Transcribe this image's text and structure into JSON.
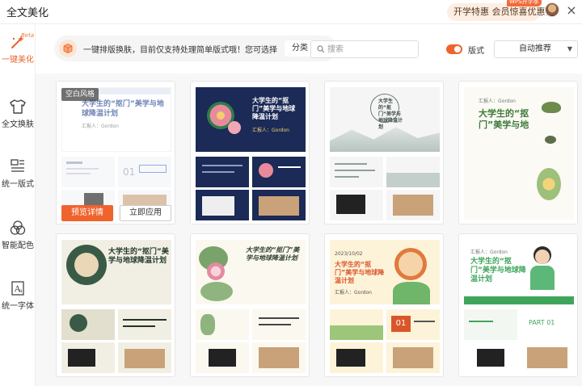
{
  "window": {
    "title": "全文美化",
    "promo_text": "开学特惠 会员惊喜优惠价",
    "promo_badge": "WPS开学季",
    "close_symbol": "×"
  },
  "sidebar": {
    "items": [
      {
        "label": "一键美化",
        "icon": "magic-wand-icon",
        "badge": "Beta",
        "active": true
      },
      {
        "label": "全文换肤",
        "icon": "tshirt-icon"
      },
      {
        "label": "统一版式",
        "icon": "layout-icon"
      },
      {
        "label": "智能配色",
        "icon": "color-circles-icon"
      },
      {
        "label": "统一字体",
        "icon": "font-icon"
      }
    ]
  },
  "toolbar": {
    "notice": "一键排版换肤，目前仅支持处理简单版式哦！您可选择",
    "classify_label": "分类",
    "search_placeholder": "搜索",
    "layout_toggle_label": "版式",
    "layout_toggle_on": true,
    "sort_value": "自动推荐"
  },
  "templates": [
    {
      "title": "大学生的“抠门”美学与地球降温计划",
      "presenter": "汇报人：Gordon",
      "style_tag": "空白风格",
      "preview_label": "预览详情",
      "apply_label": "立即应用",
      "hovered": true
    },
    {
      "title": "大学生的“抠门”美学与地球降温计划",
      "presenter": "汇报人：Gordon"
    },
    {
      "title": "大学生的“抠门”美学与地球降温计划",
      "presenter": ""
    },
    {
      "title": "大学生的“抠门”美学与地",
      "presenter": "汇报人：Gordon"
    },
    {
      "title": "大学生的“抠门”美学与地球降温计划",
      "presenter": ""
    },
    {
      "title": "大学生的“抠门”美学与地球降温计划",
      "presenter": ""
    },
    {
      "title": "大学生的“抠门”美学与地球降温计划",
      "presenter": "汇报人：Gordon",
      "date": "2023/10/02",
      "chapter": "01"
    },
    {
      "title": "大学生的“抠门”美学与地球降温计划",
      "presenter": "汇报人：Gordon",
      "chapter": "PART 01"
    }
  ],
  "colors": {
    "accent": "#f0632c",
    "card_navy": "#1b2a56",
    "card_green": "#3fa55b"
  }
}
